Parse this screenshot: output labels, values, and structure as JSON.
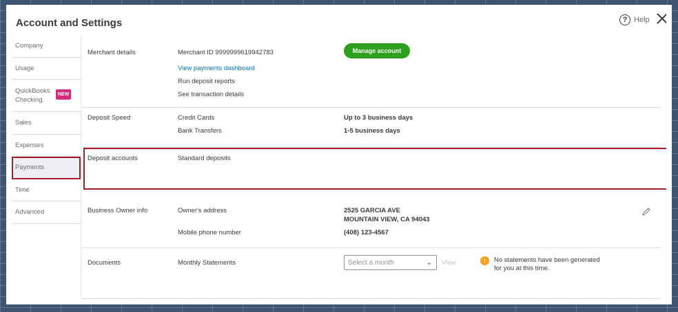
{
  "header": {
    "title": "Account and Settings",
    "help_label": "Help",
    "help_icon": "question-circle-icon",
    "close_icon": "close-icon"
  },
  "sidebar": {
    "items": [
      {
        "label": "Company"
      },
      {
        "label": "Usage"
      },
      {
        "label": "QuickBooks Checking",
        "badge": "NEW"
      },
      {
        "label": "Sales"
      },
      {
        "label": "Expenses"
      },
      {
        "label": "Payments",
        "active": true
      },
      {
        "label": "Time"
      },
      {
        "label": "Advanced"
      }
    ]
  },
  "merchant": {
    "title": "Merchant details",
    "merchant_id": "Merchant ID 9999999619942783",
    "view_dashboard": "View payments dashboard",
    "run_reports": "Run deposit reports",
    "see_details": "See transaction details",
    "manage_button": "Manage account"
  },
  "deposit_speed": {
    "title": "Deposit Speed",
    "rows": [
      {
        "label": "Credit Cards",
        "value": "Up to 3 business days"
      },
      {
        "label": "Bank Transfers",
        "value": "1-5 business days"
      }
    ]
  },
  "deposit_accounts": {
    "title": "Deposit accounts",
    "label": "Standard deposits"
  },
  "owner": {
    "title": "Business Owner info",
    "address_label": "Owner's address",
    "address_line1": "2525 GARCIA AVE",
    "address_line2": "MOUNTAIN VIEW, CA 94043",
    "phone_label": "Mobile phone number",
    "phone_value": "(408) 123-4567",
    "edit_icon": "pencil-icon"
  },
  "documents": {
    "title": "Documents",
    "label": "Monthly Statements",
    "select_placeholder": "Select a month",
    "view_label": "View",
    "warning_icon": "exclamation-icon",
    "warning_text": "No statements have been generated for you at this time."
  },
  "colors": {
    "accent_green": "#2ca01c",
    "highlight_red": "#a31f2d",
    "link_blue": "#0077c5",
    "badge_pink": "#d52b7e",
    "warning_orange": "#ff9f1a"
  }
}
